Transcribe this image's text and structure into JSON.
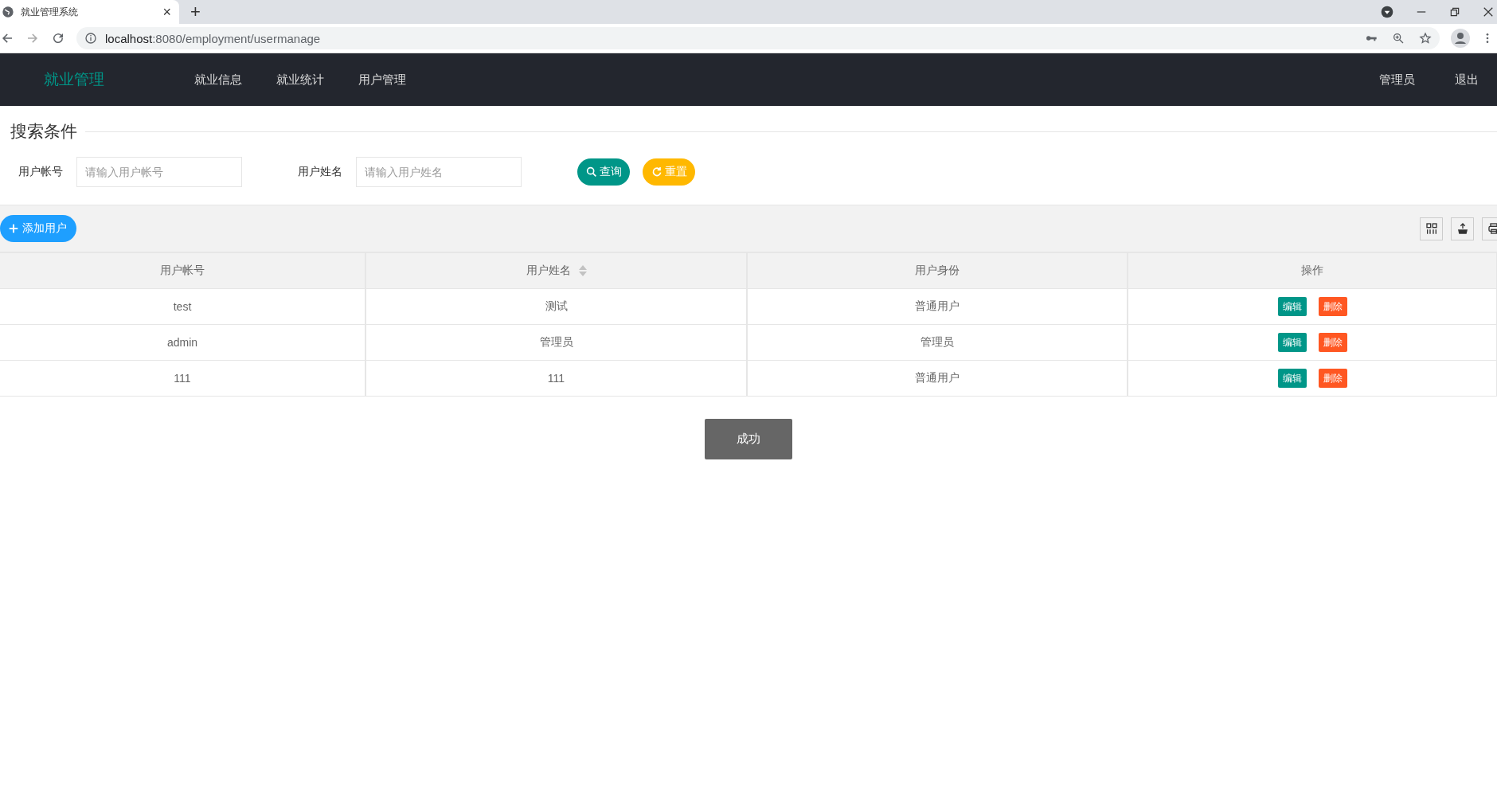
{
  "browser": {
    "tab_title": "就业管理系统",
    "tab_close": "×",
    "new_tab": "+",
    "url_host": "localhost",
    "url_rest": ":8080/employment/usermanage"
  },
  "nav": {
    "logo": "就业管理",
    "items": [
      {
        "label": "就业信息"
      },
      {
        "label": "就业统计"
      },
      {
        "label": "用户管理"
      }
    ],
    "user": "管理员",
    "logout": "退出"
  },
  "search": {
    "legend": "搜索条件",
    "fields": [
      {
        "label": "用户帐号",
        "placeholder": "请输入用户帐号"
      },
      {
        "label": "用户姓名",
        "placeholder": "请输入用户姓名"
      }
    ],
    "buttons": [
      {
        "kind": "search",
        "label": "查询"
      },
      {
        "kind": "reset",
        "label": "重置"
      }
    ]
  },
  "toolbar": {
    "add_button": "添加用户"
  },
  "table": {
    "columns": [
      {
        "label": "用户帐号",
        "sortable": false
      },
      {
        "label": "用户姓名",
        "sortable": true
      },
      {
        "label": "用户身份",
        "sortable": false
      },
      {
        "label": "操作",
        "sortable": false
      }
    ],
    "rows": [
      {
        "cells": [
          "test",
          "测试",
          "普通用户"
        ],
        "actions": [
          {
            "kind": "edit",
            "label": "编辑"
          },
          {
            "kind": "delete",
            "label": "删除"
          }
        ]
      },
      {
        "cells": [
          "admin",
          "管理员",
          "管理员"
        ],
        "actions": [
          {
            "kind": "edit",
            "label": "编辑"
          },
          {
            "kind": "delete",
            "label": "删除"
          }
        ]
      },
      {
        "cells": [
          "111",
          "111",
          "普通用户"
        ],
        "actions": [
          {
            "kind": "edit",
            "label": "编辑"
          },
          {
            "kind": "delete",
            "label": "删除"
          }
        ]
      }
    ]
  },
  "toast": "成功"
}
